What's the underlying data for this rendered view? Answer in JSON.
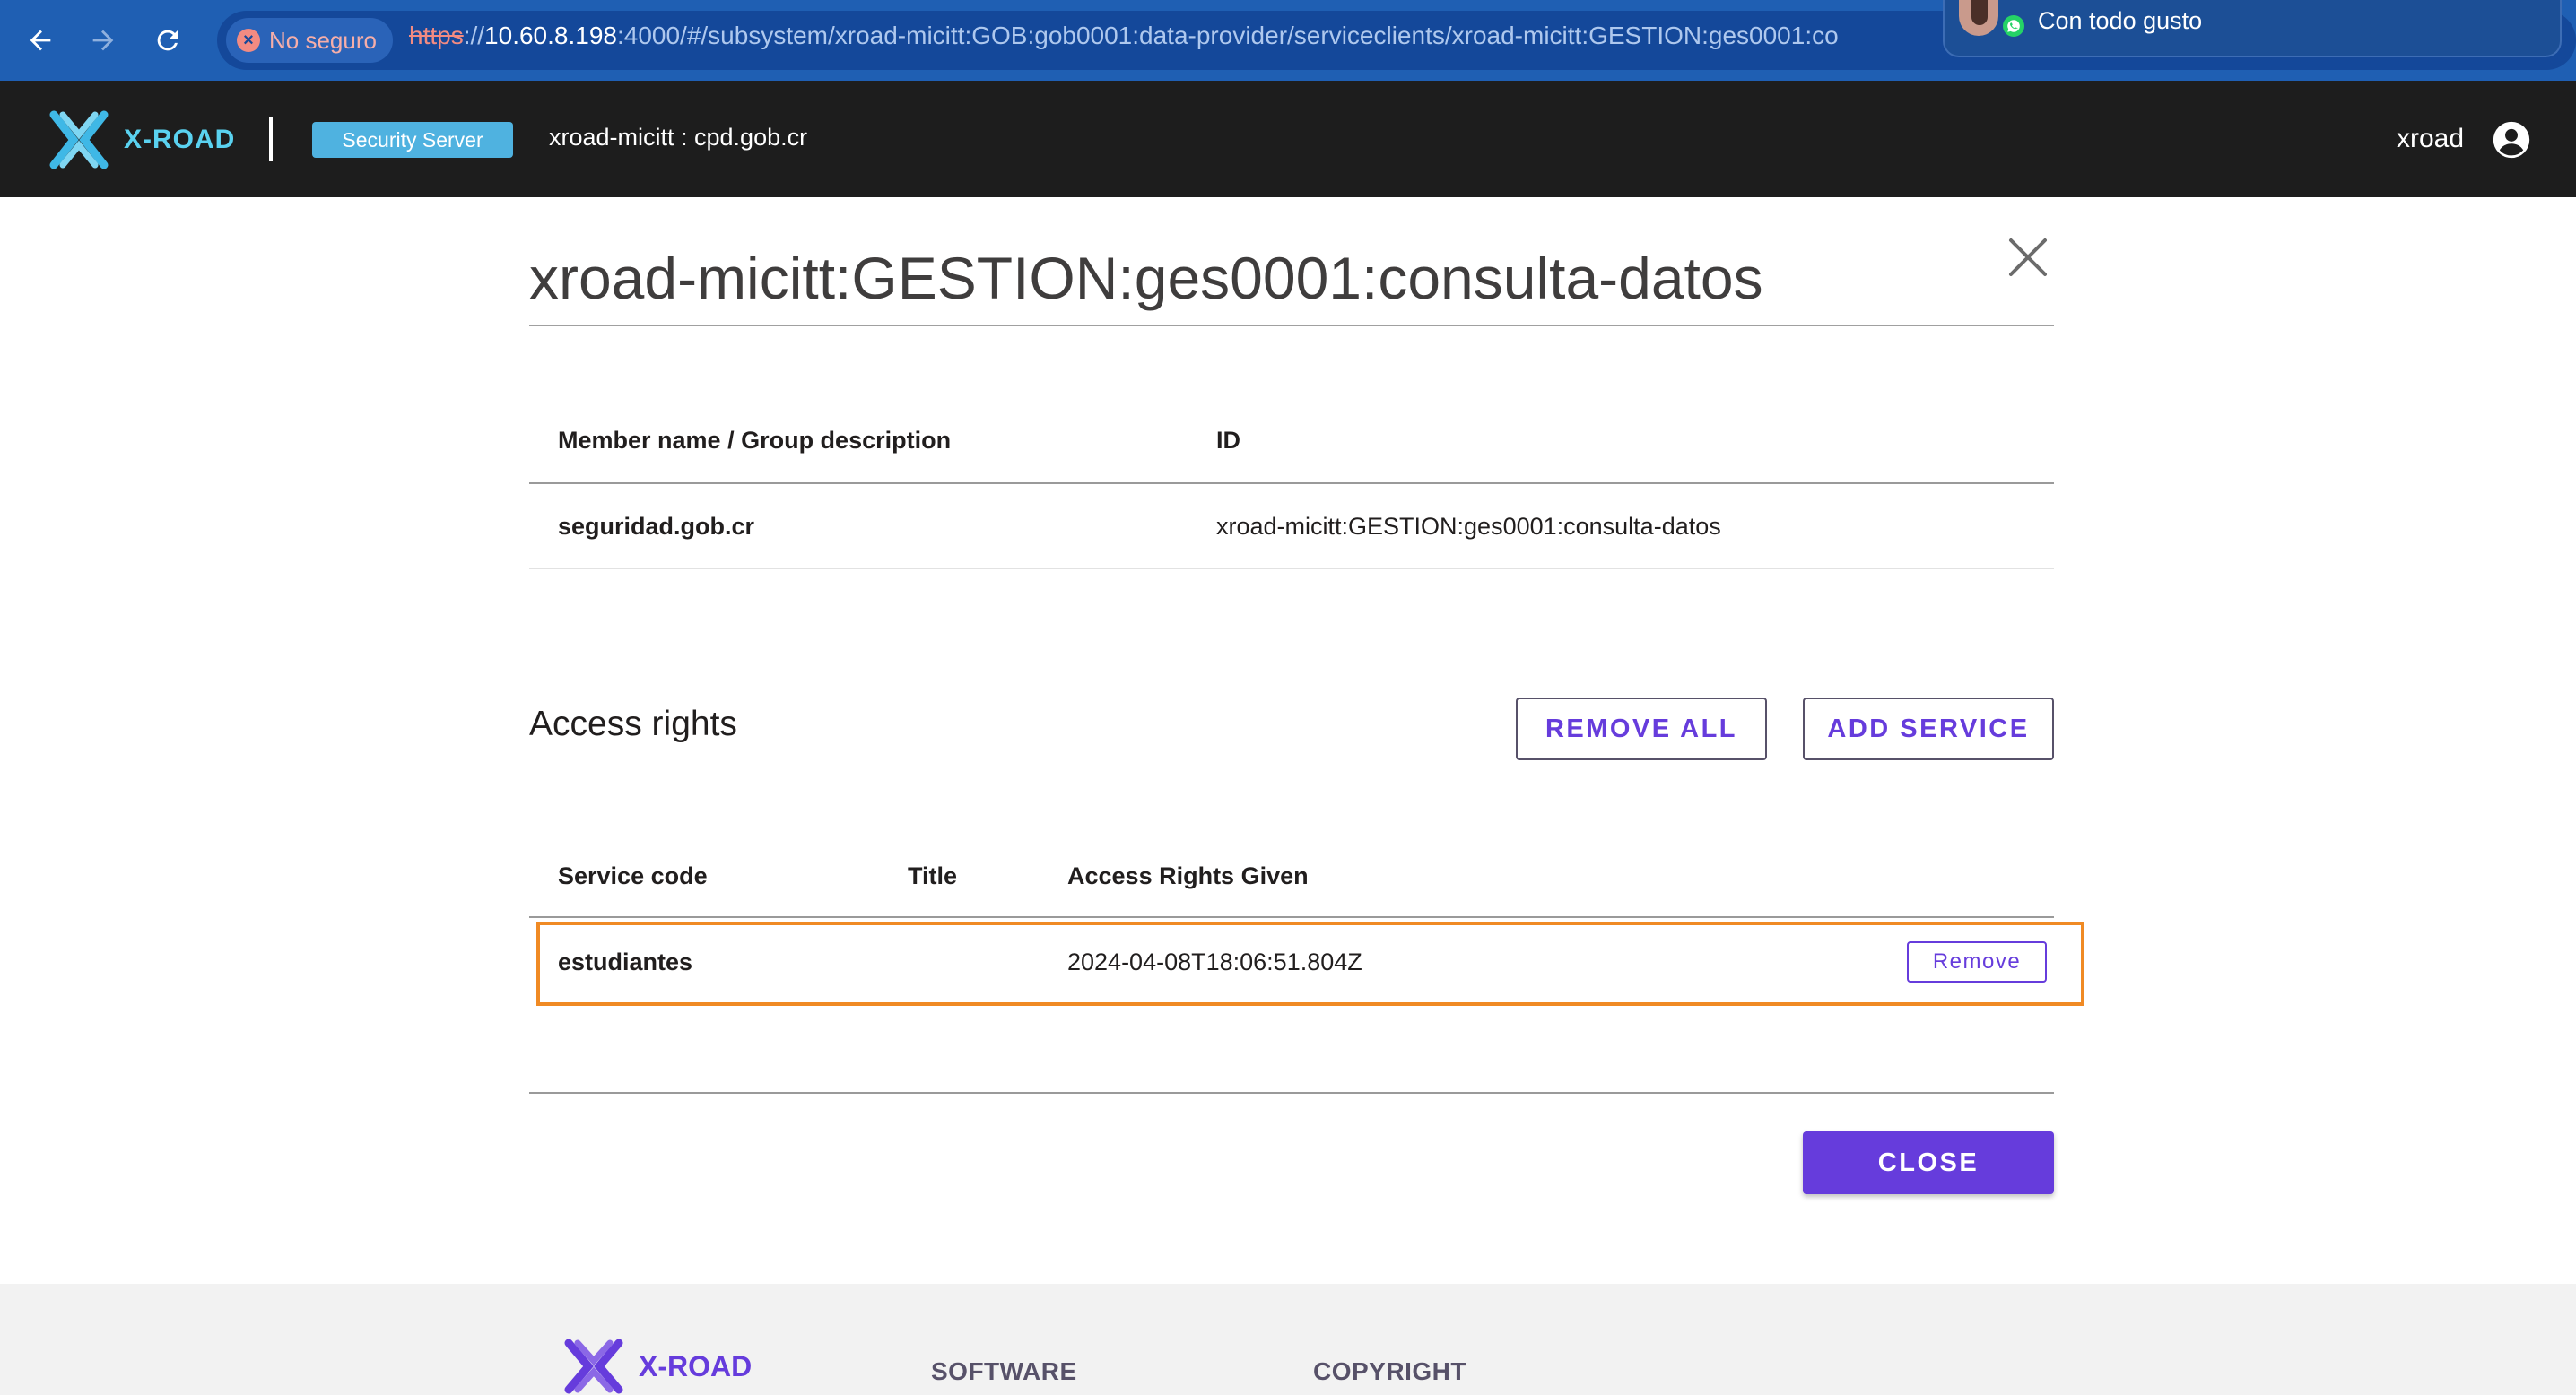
{
  "browser": {
    "security_label": "No seguro",
    "url_scheme": "https",
    "url_sep": "://",
    "url_host": "10.60.8.198",
    "url_rest": ":4000/#/subsystem/xroad-micitt:GOB:gob0001:data-provider/serviceclients/xroad-micitt:GESTION:ges0001:co",
    "notification_text": "Con todo gusto"
  },
  "header": {
    "logo_text": "X-ROAD",
    "server_chip": "Security Server",
    "server_name": "xroad-micitt : cpd.gob.cr",
    "user_name": "xroad"
  },
  "dialog": {
    "title": "xroad-micitt:GESTION:ges0001:consulta-datos",
    "member_table": {
      "headers": [
        "Member name / Group description",
        "ID"
      ],
      "rows": [
        [
          "seguridad.gob.cr",
          "xroad-micitt:GESTION:ges0001:consulta-datos"
        ]
      ]
    },
    "access_rights_title": "Access rights",
    "remove_all_label": "REMOVE ALL",
    "add_service_label": "ADD SERVICE",
    "service_table": {
      "headers": [
        "Service code",
        "Title",
        "Access Rights Given"
      ],
      "rows": [
        {
          "service_code": "estudiantes",
          "title": "",
          "given": "2024-04-08T18:06:51.804Z",
          "action": "Remove"
        }
      ]
    },
    "close_label": "CLOSE"
  },
  "footer": {
    "logo_text": "X-ROAD",
    "col1": "SOFTWARE",
    "col2": "COPYRIGHT"
  },
  "colors": {
    "browser_bar": "#1f5fb3",
    "header_bg": "#1d1d1d",
    "accent_purple": "#663cdc",
    "chip_blue": "#4fb2e0",
    "highlight_orange": "#f08a24"
  }
}
